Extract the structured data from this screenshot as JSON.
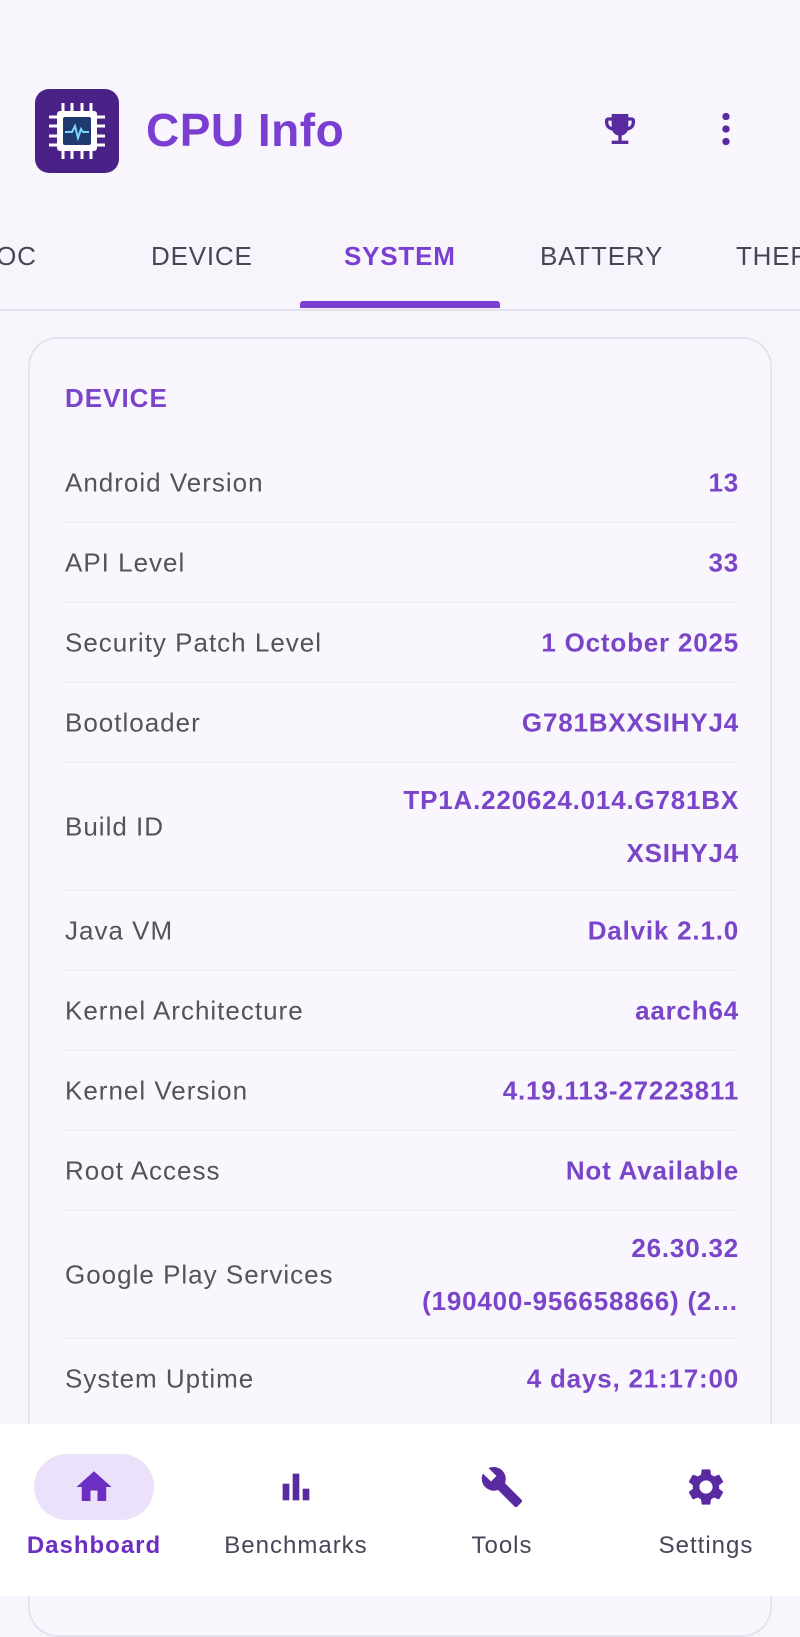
{
  "app": {
    "title": "CPU Info"
  },
  "icons": {
    "logo": "cpu-chip-icon",
    "trophy": "trophy-icon",
    "menu": "more-vert-icon"
  },
  "colors": {
    "accent": "#7a3fd0",
    "logo_bg": "#4a2187",
    "value": "#7a45c9"
  },
  "tabs": [
    {
      "label": "SOC",
      "partial": true
    },
    {
      "label": "DEVICE"
    },
    {
      "label": "SYSTEM",
      "active": true
    },
    {
      "label": "BATTERY"
    },
    {
      "label": "THERMAL",
      "partial": true
    }
  ],
  "card": {
    "title": "DEVICE",
    "rows": [
      {
        "label": "Android Version",
        "value": "13"
      },
      {
        "label": "API Level",
        "value": "33"
      },
      {
        "label": "Security Patch Level",
        "value": "1 October 2025"
      },
      {
        "label": "Bootloader",
        "value": "G781BXXSIHYJ4"
      },
      {
        "label": "Build ID",
        "value": "TP1A.220624.014.G781BXXSIHYJ4"
      },
      {
        "label": "Java VM",
        "value": "Dalvik 2.1.0"
      },
      {
        "label": "Kernel Architecture",
        "value": "aarch64"
      },
      {
        "label": "Kernel Version",
        "value": "4.19.113-27223811"
      },
      {
        "label": "Root Access",
        "value": "Not Available"
      },
      {
        "label": "Google Play Services",
        "value_line1": "26.30.32",
        "value_line2": "(190400-956658866) (2…"
      },
      {
        "label": "System Uptime",
        "value": "4 days, 21:17:00"
      }
    ]
  },
  "nav": [
    {
      "label": "Dashboard",
      "icon": "home-icon",
      "active": true
    },
    {
      "label": "Benchmarks",
      "icon": "bar-chart-icon"
    },
    {
      "label": "Tools",
      "icon": "wrench-icon"
    },
    {
      "label": "Settings",
      "icon": "gear-icon"
    }
  ]
}
